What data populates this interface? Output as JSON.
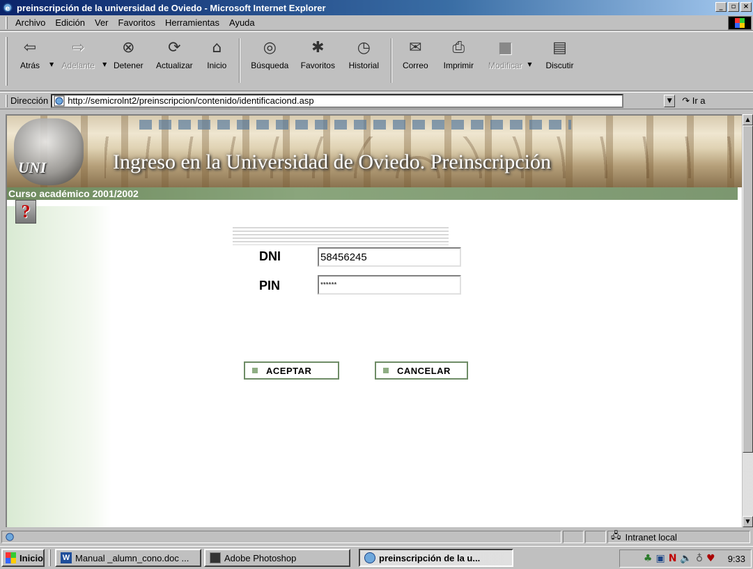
{
  "window": {
    "title": "preinscripción de la universidad de Oviedo - Microsoft Internet Explorer",
    "controls": [
      "_",
      "▫",
      "×"
    ]
  },
  "menu": {
    "items": [
      {
        "label": "Archivo"
      },
      {
        "label": "Edición"
      },
      {
        "label": "Ver"
      },
      {
        "label": "Favoritos"
      },
      {
        "label": "Herramientas"
      },
      {
        "label": "Ayuda"
      }
    ]
  },
  "toolbar": {
    "back": "Atrás",
    "forward": "Adelante",
    "stop": "Detener",
    "refresh": "Actualizar",
    "home": "Inicio",
    "search": "Búsqueda",
    "favorites": "Favoritos",
    "history": "Historial",
    "mail": "Correo",
    "print": "Imprimir",
    "edit": "Modificar",
    "discuss": "Discutir",
    "icons": {
      "back": "left-arrow-icon",
      "forward": "right-arrow-icon",
      "stop": "stop-icon",
      "refresh": "refresh-icon",
      "home": "home-icon",
      "search": "search-icon",
      "favorites": "favorites-icon",
      "history": "history-icon",
      "mail": "mail-icon",
      "print": "printer-icon",
      "edit": "edit-icon",
      "discuss": "discuss-icon"
    }
  },
  "address": {
    "label": "Dirección",
    "url": "http://semicrolnt2/preinscripcion/contenido/identificaciond.asp",
    "go_label": "Ir a"
  },
  "page": {
    "banner_title": "Ingreso en la Universidad de Oviedo. Preinscripción",
    "seal_text": "UNI",
    "course": "Curso académico 2001/2002",
    "help_symbol": "?",
    "form": {
      "dni_label": "DNI",
      "dni_value": "58456245",
      "pin_label": "PIN",
      "pin_value": "******"
    },
    "buttons": {
      "accept": "ACEPTAR",
      "cancel": "CANCELAR"
    },
    "colors": {
      "accent_green": "#6e8c66",
      "course_bar": "#7c9770"
    }
  },
  "status": {
    "zone": "Intranet local"
  },
  "taskbar": {
    "start": "Inicio",
    "tasks": [
      {
        "label": "Manual _alumn_cono.doc ..."
      },
      {
        "label": "Adobe Photoshop"
      },
      {
        "label": "preinscripción de la u..."
      }
    ],
    "clock": "9:33"
  }
}
